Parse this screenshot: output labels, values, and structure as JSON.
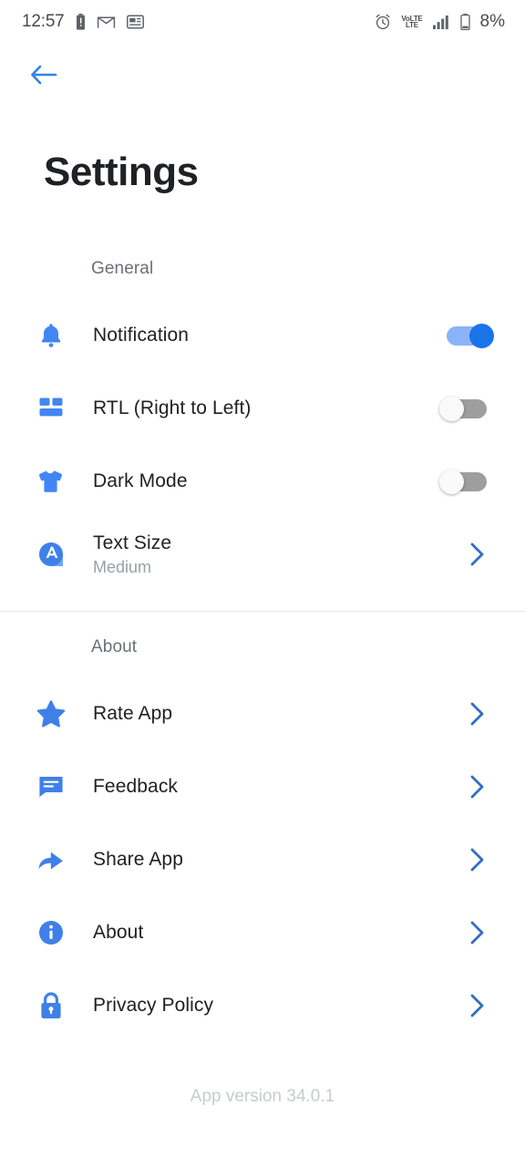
{
  "status_bar": {
    "time": "12:57",
    "battery_percent": "8%",
    "left_icons": [
      "battery-alert-icon",
      "gmail-icon",
      "news-icon"
    ],
    "right_icons": [
      "alarm-icon",
      "volte-icon",
      "signal-icon",
      "battery-icon"
    ],
    "volte_top": "VoLTE",
    "volte_bottom": "LTE"
  },
  "navbar": {
    "back_icon": "back-arrow-icon"
  },
  "page": {
    "title": "Settings"
  },
  "general": {
    "label": "General",
    "items": [
      {
        "label": "Notification",
        "icon": "bell-icon",
        "control": "toggle",
        "state": "on"
      },
      {
        "label": "RTL (Right to Left)",
        "icon": "dashboard-icon",
        "control": "toggle",
        "state": "off"
      },
      {
        "label": "Dark Mode",
        "icon": "tshirt-icon",
        "control": "toggle",
        "state": "off"
      },
      {
        "label": "Text Size",
        "sub": "Medium",
        "icon": "font-size-icon",
        "control": "chevron"
      }
    ]
  },
  "about": {
    "label": "About",
    "items": [
      {
        "label": "Rate App",
        "icon": "star-icon",
        "control": "chevron"
      },
      {
        "label": "Feedback",
        "icon": "chat-icon",
        "control": "chevron"
      },
      {
        "label": "Share App",
        "icon": "share-icon",
        "control": "chevron"
      },
      {
        "label": "About",
        "icon": "info-icon",
        "control": "chevron"
      },
      {
        "label": "Privacy Policy",
        "icon": "lock-icon",
        "control": "chevron"
      }
    ]
  },
  "footer": {
    "version": "App version 34.0.1"
  },
  "colors": {
    "accent": "#4285f4",
    "accent_strong": "#1a73e8",
    "toggle_on_track": "#8ab4f8",
    "toggle_off_track": "#9e9e9e",
    "text_primary": "#202124",
    "text_secondary": "#6b7075",
    "text_muted": "#9aa0a6",
    "version_text": "#c8cccf",
    "divider": "#e6e6e6",
    "background": "#ffffff"
  }
}
